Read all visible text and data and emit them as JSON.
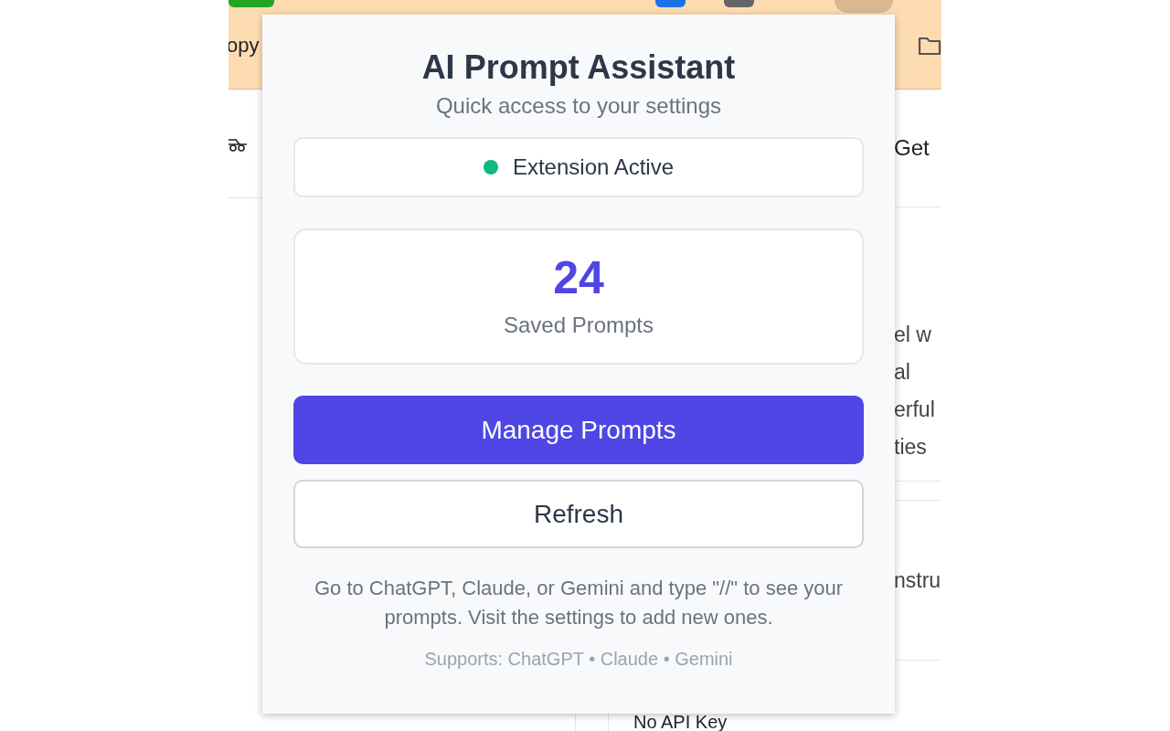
{
  "browser": {
    "toolbar_text": "opy",
    "side_label": "Get",
    "card_lines": [
      "el w",
      "al",
      "erful",
      "ties"
    ],
    "card_2_text": "nstru",
    "bottom_text": "No API Key"
  },
  "popup": {
    "title": "AI Prompt Assistant",
    "subtitle": "Quick access to your settings",
    "status": {
      "label": "Extension Active",
      "active": true,
      "color": "#10b981"
    },
    "stats": {
      "count": "24",
      "label": "Saved Prompts"
    },
    "buttons": [
      {
        "label": "Manage Prompts",
        "kind": "primary"
      },
      {
        "label": "Refresh",
        "kind": "secondary"
      }
    ],
    "help": "Go to ChatGPT, Claude, or Gemini and type \"//\" to see your prompts. Visit the settings to add new ones.",
    "supports": "Supports: ChatGPT • Claude • Gemini"
  }
}
